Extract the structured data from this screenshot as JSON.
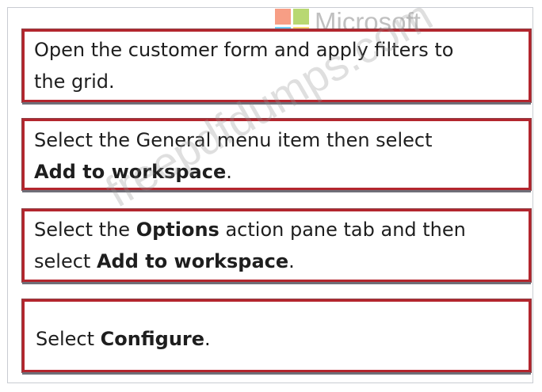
{
  "steps": [
    {
      "line1": "Open the customer form and apply filters to",
      "line2": "the grid."
    },
    {
      "line1": "Select the General menu item then select",
      "line2_bold": "Add to workspace",
      "line2_end": "."
    },
    {
      "line1_pre": "Select the ",
      "line1_bold": "Options",
      "line1_post": " action pane tab and then",
      "line2_pre": "select ",
      "line2_bold": "Add to workspace",
      "line2_end": "."
    },
    {
      "pre": "Select ",
      "bold": "Configure",
      "end": "."
    }
  ],
  "logo": {
    "text": "Microsoft",
    "colors": [
      "#f25022",
      "#7fba00",
      "#00a4ef",
      "#ffb900"
    ]
  },
  "watermark": "freepdfdumps.com"
}
